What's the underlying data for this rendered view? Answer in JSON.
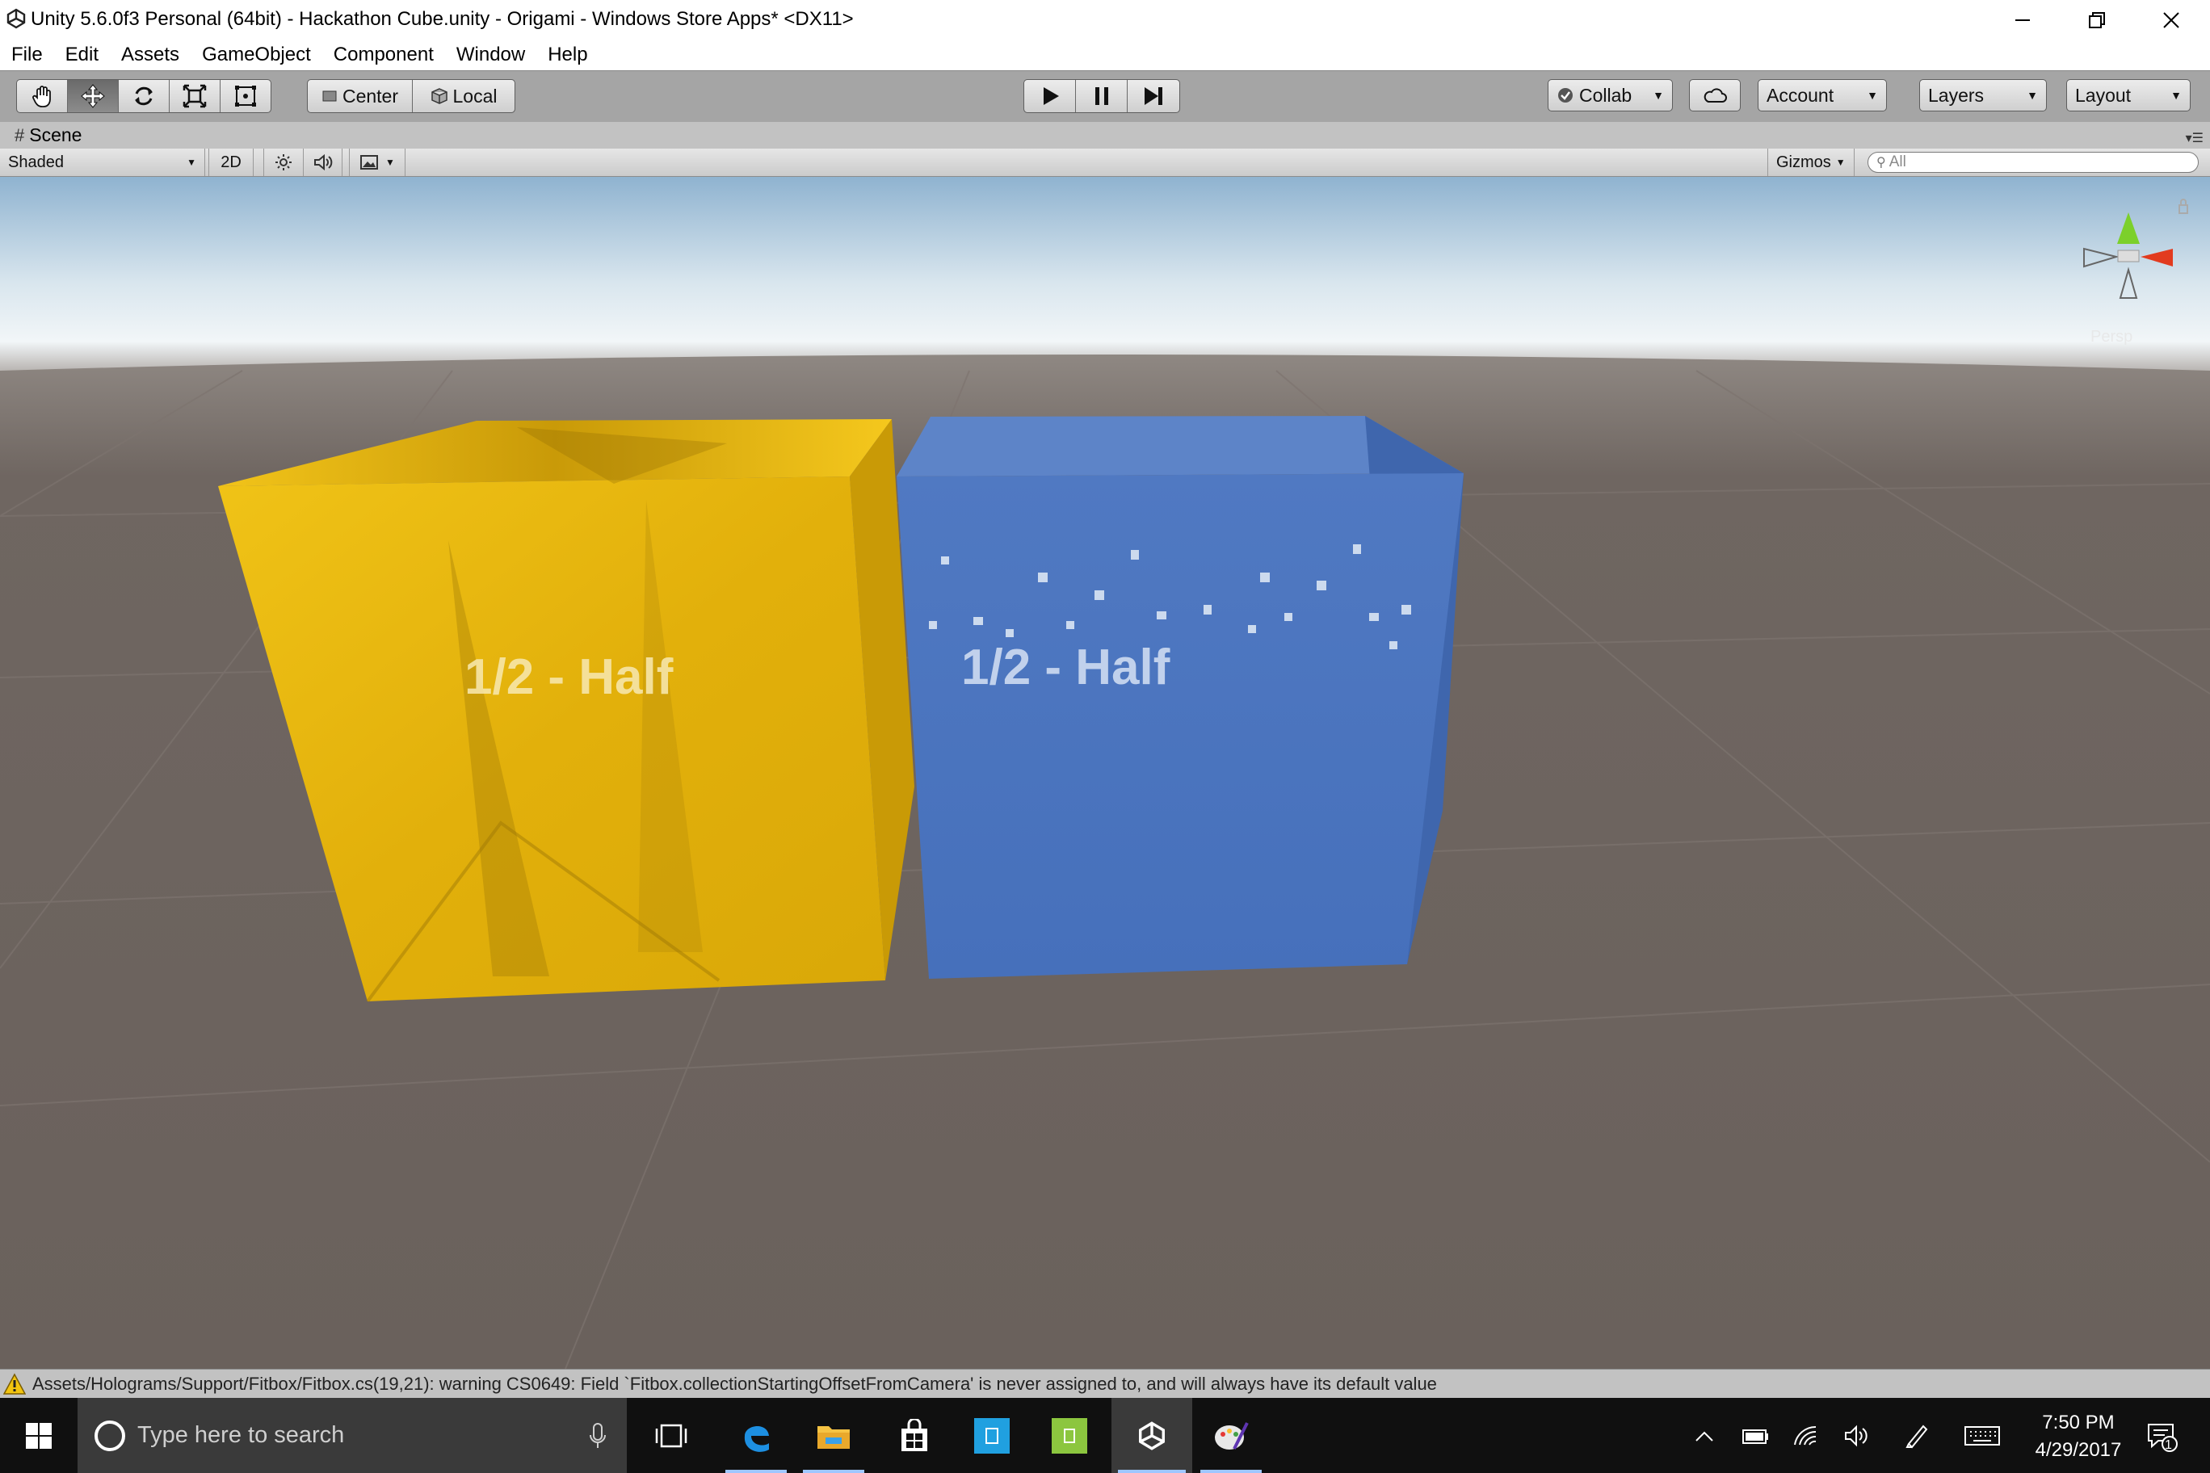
{
  "window": {
    "title": "Unity 5.6.0f3 Personal (64bit) - Hackathon Cube.unity - Origami - Windows Store Apps* <DX11>",
    "icons": [
      "unity-logo-icon",
      "minimize-icon",
      "restore-icon",
      "close-icon"
    ]
  },
  "menu": [
    "File",
    "Edit",
    "Assets",
    "GameObject",
    "Component",
    "Window",
    "Help"
  ],
  "toolbar": {
    "tools": [
      "hand-tool-icon",
      "move-tool-icon",
      "rotate-tool-icon",
      "scale-tool-icon",
      "rect-tool-icon"
    ],
    "active_tool": "move-tool-icon",
    "pivot_center": "Center",
    "pivot_local": "Local",
    "playback": [
      "play-icon",
      "pause-icon",
      "step-icon"
    ],
    "collab": "Collab",
    "account": "Account",
    "layers": "Layers",
    "layout": "Layout"
  },
  "scene": {
    "tab_label": "Scene",
    "shading_mode": "Shaded",
    "mode_2d": "2D",
    "gizmos": "Gizmos",
    "search_placeholder": "All",
    "gizmo_view_label": "Persp"
  },
  "viewport_content": {
    "cube_left_text": "1/2 - Half",
    "cube_right_text": "1/2 - Half",
    "colors": {
      "sky_top": "#8fb3d0",
      "sky_horizon": "#f2f6f8",
      "ground": "#6b625d",
      "cube_left": "#e8b80d",
      "cube_right": "#4a73bc",
      "grid": "#7b736e"
    }
  },
  "status": {
    "message": "Assets/Holograms/Support/Fitbox/Fitbox.cs(19,21): warning CS0649: Field `Fitbox.collectionStartingOffsetFromCamera' is never assigned to, and will always have its default value"
  },
  "taskbar": {
    "search_placeholder": "Type here to search",
    "time": "7:50 PM",
    "date": "4/29/2017",
    "notification_count": "1",
    "apps": [
      "task-view-icon",
      "edge-icon",
      "file-explorer-icon",
      "store-icon",
      "blue-app-icon",
      "green-app-icon",
      "unity-taskbar-icon",
      "paint-app-icon"
    ],
    "tray": [
      "chevron-up-icon",
      "battery-icon",
      "wifi-icon",
      "volume-icon",
      "pen-icon",
      "keyboard-icon"
    ]
  }
}
